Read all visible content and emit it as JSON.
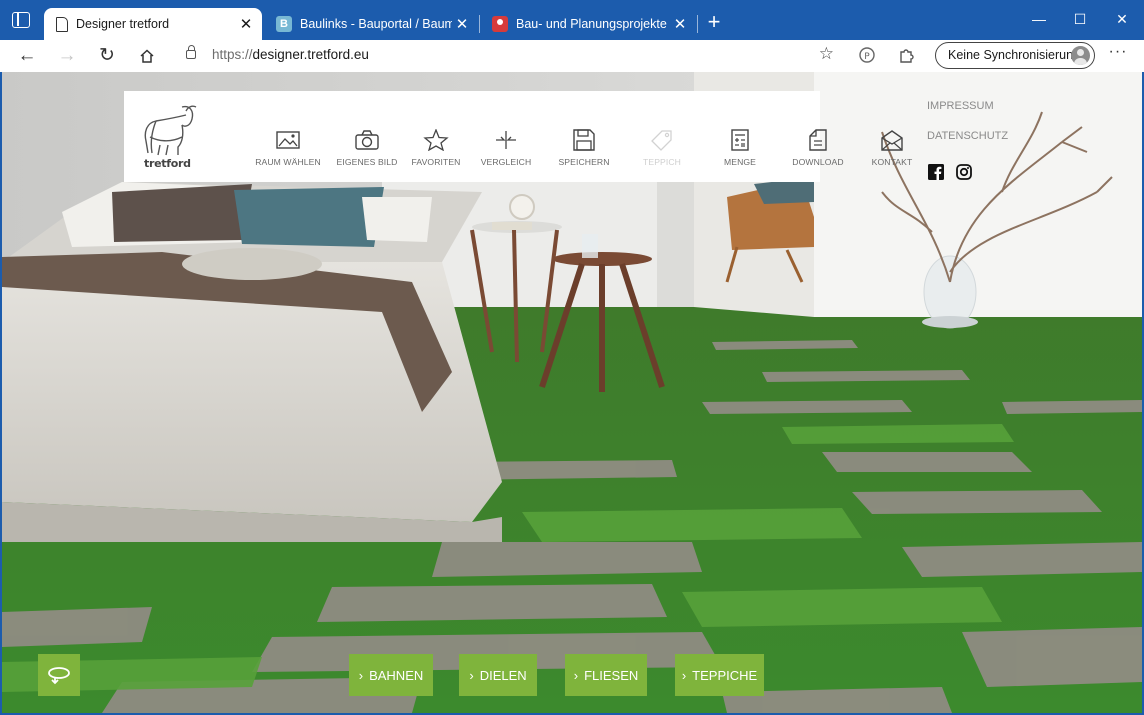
{
  "browser": {
    "tabs": [
      {
        "title": "Designer tretford",
        "favicon": "page-icon",
        "active": true
      },
      {
        "title": "Baulinks - Bauportal / Baumagazin",
        "favicon": "b-icon",
        "active": false
      },
      {
        "title": "Bau- und Planungsprojekte auf Bau",
        "favicon": "map-pin-icon",
        "active": false
      }
    ],
    "address": {
      "scheme": "https://",
      "host": "designer.tretford.eu"
    },
    "sync_label": "Keine Synchronisierung"
  },
  "site": {
    "logo_text": "tretford",
    "nav": [
      {
        "label": "RAUM WÄHLEN",
        "icon": "room-image-icon",
        "enabled": true
      },
      {
        "label": "EIGENES BILD",
        "icon": "camera-icon",
        "enabled": true
      },
      {
        "label": "FAVORITEN",
        "icon": "star-icon",
        "enabled": true
      },
      {
        "label": "VERGLEICH",
        "icon": "compare-icon",
        "enabled": true
      },
      {
        "label": "SPEICHERN",
        "icon": "floppy-disk-icon",
        "enabled": true
      },
      {
        "label": "TEPPICH",
        "icon": "tag-icon",
        "enabled": false
      },
      {
        "label": "MENGE",
        "icon": "calculator-icon",
        "enabled": true
      },
      {
        "label": "DOWNLOAD",
        "icon": "document-icon",
        "enabled": true
      },
      {
        "label": "KONTAKT",
        "icon": "envelope-icon",
        "enabled": true
      }
    ],
    "side_links": {
      "impressum": "IMPRESSUM",
      "datenschutz": "DATENSCHUTZ"
    },
    "bottom_buttons": [
      "BAHNEN",
      "DIELEN",
      "FLIESEN",
      "TEPPICHE"
    ],
    "colors": {
      "accent": "#7fb43c",
      "browser_frame": "#1c5cad"
    }
  }
}
